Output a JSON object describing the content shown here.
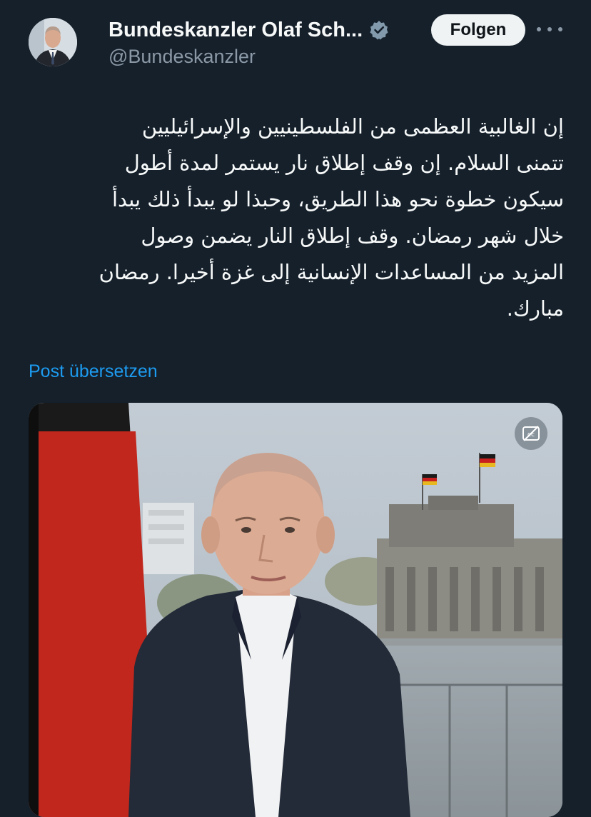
{
  "author": {
    "display_name": "Bundeskanzler Olaf Sch...",
    "handle": "@Bundeskanzler",
    "avatar_icon": "person-portrait",
    "verified_icon": "verified-badge-icon"
  },
  "header": {
    "follow_label": "Folgen",
    "more_icon": "more-horizontal-icon"
  },
  "tweet": {
    "direction": "rtl",
    "lines": [
      "إن الغالبية العظمى من الفلسطينيين والإسرائيليين",
      "تتمنى السلام. إن وقف إطلاق نار يستمر لمدة أطول",
      "سيكون خطوة نحو هذا الطريق، وحبذا لو يبدأ ذلك يبدأ",
      "خلال شهر رمضان. وقف إطلاق النار يضمن وصول",
      "المزيد من المساعدات الإنسانية إلى غزة أخيرا. رمضان",
      "مبارك."
    ]
  },
  "translate_link": "Post übersetzen",
  "media": {
    "type": "video",
    "captions_icon": "captions-off-icon"
  },
  "colors": {
    "background": "#15202b",
    "text": "#f7f9f9",
    "secondary_text": "#8b98a5",
    "link": "#1d9bf0",
    "follow_button_bg": "#eff3f4",
    "follow_button_text": "#0f1419"
  }
}
